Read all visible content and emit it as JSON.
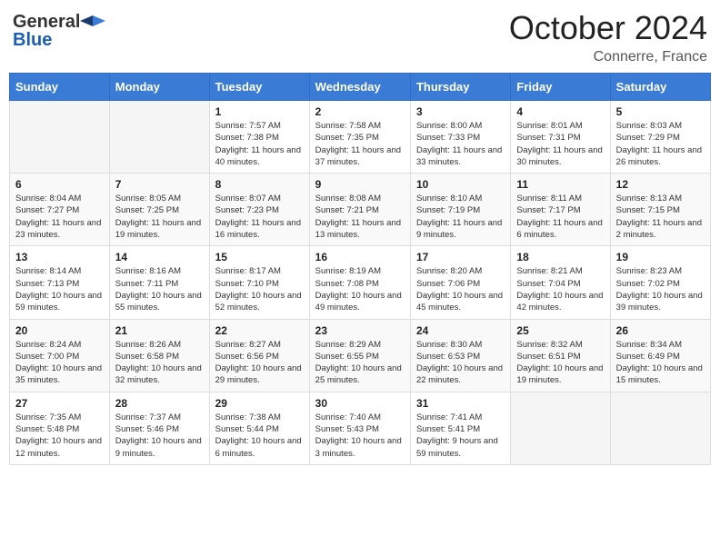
{
  "header": {
    "logo_general": "General",
    "logo_blue": "Blue",
    "month_title": "October 2024",
    "location": "Connerre, France"
  },
  "weekdays": [
    "Sunday",
    "Monday",
    "Tuesday",
    "Wednesday",
    "Thursday",
    "Friday",
    "Saturday"
  ],
  "weeks": [
    [
      {
        "day": "",
        "info": ""
      },
      {
        "day": "",
        "info": ""
      },
      {
        "day": "1",
        "info": "Sunrise: 7:57 AM\nSunset: 7:38 PM\nDaylight: 11 hours and 40 minutes."
      },
      {
        "day": "2",
        "info": "Sunrise: 7:58 AM\nSunset: 7:35 PM\nDaylight: 11 hours and 37 minutes."
      },
      {
        "day": "3",
        "info": "Sunrise: 8:00 AM\nSunset: 7:33 PM\nDaylight: 11 hours and 33 minutes."
      },
      {
        "day": "4",
        "info": "Sunrise: 8:01 AM\nSunset: 7:31 PM\nDaylight: 11 hours and 30 minutes."
      },
      {
        "day": "5",
        "info": "Sunrise: 8:03 AM\nSunset: 7:29 PM\nDaylight: 11 hours and 26 minutes."
      }
    ],
    [
      {
        "day": "6",
        "info": "Sunrise: 8:04 AM\nSunset: 7:27 PM\nDaylight: 11 hours and 23 minutes."
      },
      {
        "day": "7",
        "info": "Sunrise: 8:05 AM\nSunset: 7:25 PM\nDaylight: 11 hours and 19 minutes."
      },
      {
        "day": "8",
        "info": "Sunrise: 8:07 AM\nSunset: 7:23 PM\nDaylight: 11 hours and 16 minutes."
      },
      {
        "day": "9",
        "info": "Sunrise: 8:08 AM\nSunset: 7:21 PM\nDaylight: 11 hours and 13 minutes."
      },
      {
        "day": "10",
        "info": "Sunrise: 8:10 AM\nSunset: 7:19 PM\nDaylight: 11 hours and 9 minutes."
      },
      {
        "day": "11",
        "info": "Sunrise: 8:11 AM\nSunset: 7:17 PM\nDaylight: 11 hours and 6 minutes."
      },
      {
        "day": "12",
        "info": "Sunrise: 8:13 AM\nSunset: 7:15 PM\nDaylight: 11 hours and 2 minutes."
      }
    ],
    [
      {
        "day": "13",
        "info": "Sunrise: 8:14 AM\nSunset: 7:13 PM\nDaylight: 10 hours and 59 minutes."
      },
      {
        "day": "14",
        "info": "Sunrise: 8:16 AM\nSunset: 7:11 PM\nDaylight: 10 hours and 55 minutes."
      },
      {
        "day": "15",
        "info": "Sunrise: 8:17 AM\nSunset: 7:10 PM\nDaylight: 10 hours and 52 minutes."
      },
      {
        "day": "16",
        "info": "Sunrise: 8:19 AM\nSunset: 7:08 PM\nDaylight: 10 hours and 49 minutes."
      },
      {
        "day": "17",
        "info": "Sunrise: 8:20 AM\nSunset: 7:06 PM\nDaylight: 10 hours and 45 minutes."
      },
      {
        "day": "18",
        "info": "Sunrise: 8:21 AM\nSunset: 7:04 PM\nDaylight: 10 hours and 42 minutes."
      },
      {
        "day": "19",
        "info": "Sunrise: 8:23 AM\nSunset: 7:02 PM\nDaylight: 10 hours and 39 minutes."
      }
    ],
    [
      {
        "day": "20",
        "info": "Sunrise: 8:24 AM\nSunset: 7:00 PM\nDaylight: 10 hours and 35 minutes."
      },
      {
        "day": "21",
        "info": "Sunrise: 8:26 AM\nSunset: 6:58 PM\nDaylight: 10 hours and 32 minutes."
      },
      {
        "day": "22",
        "info": "Sunrise: 8:27 AM\nSunset: 6:56 PM\nDaylight: 10 hours and 29 minutes."
      },
      {
        "day": "23",
        "info": "Sunrise: 8:29 AM\nSunset: 6:55 PM\nDaylight: 10 hours and 25 minutes."
      },
      {
        "day": "24",
        "info": "Sunrise: 8:30 AM\nSunset: 6:53 PM\nDaylight: 10 hours and 22 minutes."
      },
      {
        "day": "25",
        "info": "Sunrise: 8:32 AM\nSunset: 6:51 PM\nDaylight: 10 hours and 19 minutes."
      },
      {
        "day": "26",
        "info": "Sunrise: 8:34 AM\nSunset: 6:49 PM\nDaylight: 10 hours and 15 minutes."
      }
    ],
    [
      {
        "day": "27",
        "info": "Sunrise: 7:35 AM\nSunset: 5:48 PM\nDaylight: 10 hours and 12 minutes."
      },
      {
        "day": "28",
        "info": "Sunrise: 7:37 AM\nSunset: 5:46 PM\nDaylight: 10 hours and 9 minutes."
      },
      {
        "day": "29",
        "info": "Sunrise: 7:38 AM\nSunset: 5:44 PM\nDaylight: 10 hours and 6 minutes."
      },
      {
        "day": "30",
        "info": "Sunrise: 7:40 AM\nSunset: 5:43 PM\nDaylight: 10 hours and 3 minutes."
      },
      {
        "day": "31",
        "info": "Sunrise: 7:41 AM\nSunset: 5:41 PM\nDaylight: 9 hours and 59 minutes."
      },
      {
        "day": "",
        "info": ""
      },
      {
        "day": "",
        "info": ""
      }
    ]
  ]
}
